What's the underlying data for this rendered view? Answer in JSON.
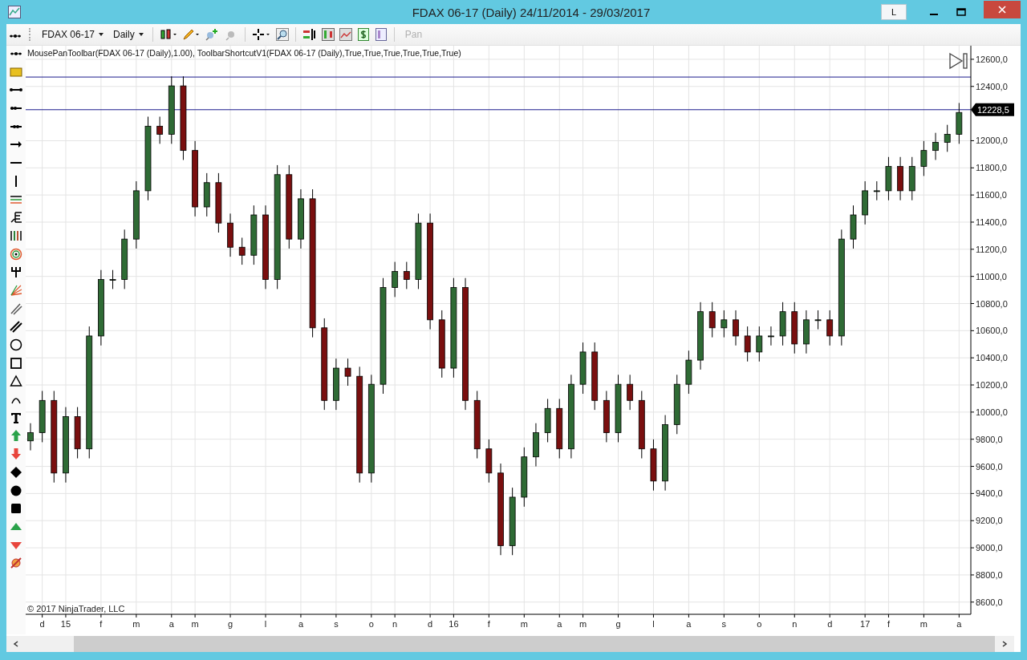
{
  "window": {
    "title": "FDAX 06-17 (Daily)  24/11/2014 - 29/03/2017",
    "title_button": "L"
  },
  "toolbar": {
    "instrument": "FDAX 06-17",
    "interval": "Daily",
    "pan": {
      "label": "Pan",
      "disabled": true
    }
  },
  "chart": {
    "indicator_label": "MousePanToolbar(FDAX 06-17 (Daily),1.00), ToolbarShortcutV1(FDAX 06-17 (Daily),True,True,True,True,True,True)",
    "copyright": "© 2017 NinjaTrader, LLC",
    "chart_data": {
      "type": "candlestick",
      "ylim": [
        8510,
        12700
      ],
      "grid": true,
      "yticks": [
        {
          "value": 12600,
          "label": "12600,0"
        },
        {
          "value": 12400,
          "label": "12400,0"
        },
        {
          "value": 12000,
          "label": "12000,0"
        },
        {
          "value": 11800,
          "label": "11800,0"
        },
        {
          "value": 11600,
          "label": "11600,0"
        },
        {
          "value": 11400,
          "label": "11400,0"
        },
        {
          "value": 11200,
          "label": "11200,0"
        },
        {
          "value": 11000,
          "label": "11000,0"
        },
        {
          "value": 10800,
          "label": "10800,0"
        },
        {
          "value": 10600,
          "label": "10600,0"
        },
        {
          "value": 10400,
          "label": "10400,0"
        },
        {
          "value": 10200,
          "label": "10200,0"
        },
        {
          "value": 10000,
          "label": "10000,0"
        },
        {
          "value": 9800,
          "label": "9800,0"
        },
        {
          "value": 9600,
          "label": "9600,0"
        },
        {
          "value": 9400,
          "label": "9400,0"
        },
        {
          "value": 9200,
          "label": "9200,0"
        },
        {
          "value": 9000,
          "label": "9000,0"
        },
        {
          "value": 8800,
          "label": "8800,0"
        },
        {
          "value": 8600,
          "label": "8600,0"
        }
      ],
      "categories": [
        null,
        "d",
        null,
        "15",
        null,
        null,
        "f",
        null,
        null,
        "m",
        null,
        null,
        "a",
        null,
        "m",
        null,
        null,
        "g",
        null,
        null,
        "l",
        null,
        null,
        "a",
        null,
        null,
        "s",
        null,
        null,
        "o",
        null,
        "n",
        null,
        null,
        "d",
        null,
        "16",
        null,
        null,
        "f",
        null,
        null,
        "m",
        null,
        null,
        "a",
        null,
        "m",
        null,
        null,
        "g",
        null,
        null,
        "l",
        null,
        null,
        "a",
        null,
        null,
        "s",
        null,
        null,
        "o",
        null,
        null,
        "n",
        null,
        null,
        "d",
        null,
        null,
        "17",
        null,
        "f",
        null,
        null,
        "m",
        null,
        null,
        "a"
      ],
      "ohlc": [
        [
          9788,
          9918,
          9718,
          9848
        ],
        [
          9848,
          10156,
          9778,
          10086
        ],
        [
          10086,
          10156,
          9481,
          9551
        ],
        [
          9551,
          10037,
          9481,
          9967
        ],
        [
          9967,
          10037,
          9659,
          9729
        ],
        [
          9729,
          10631,
          9659,
          10561
        ],
        [
          10561,
          11047,
          10491,
          10977
        ],
        [
          10977,
          11047,
          10907,
          10977
        ],
        [
          10977,
          11345,
          10907,
          11275
        ],
        [
          11275,
          11701,
          11205,
          11631
        ],
        [
          11631,
          12177,
          11561,
          12107
        ],
        [
          12107,
          12177,
          11977,
          12047
        ],
        [
          12047,
          12474,
          11977,
          12404
        ],
        [
          12404,
          12474,
          11858,
          11928
        ],
        [
          11928,
          11998,
          11442,
          11512
        ],
        [
          11512,
          11761,
          11442,
          11691
        ],
        [
          11691,
          11761,
          11323,
          11393
        ],
        [
          11393,
          11463,
          11145,
          11215
        ],
        [
          11215,
          11285,
          11086,
          11156
        ],
        [
          11156,
          11523,
          11086,
          11453
        ],
        [
          11453,
          11523,
          10907,
          10977
        ],
        [
          10977,
          11820,
          10907,
          11750
        ],
        [
          11750,
          11820,
          11205,
          11275
        ],
        [
          11275,
          11642,
          11205,
          11572
        ],
        [
          11572,
          11642,
          10551,
          10621
        ],
        [
          10621,
          10691,
          10016,
          10086
        ],
        [
          10086,
          10394,
          10016,
          10324
        ],
        [
          10324,
          10394,
          10194,
          10264
        ],
        [
          10264,
          10334,
          9481,
          9551
        ],
        [
          9551,
          10275,
          9481,
          10205
        ],
        [
          10205,
          10988,
          10135,
          10918
        ],
        [
          10918,
          11107,
          10848,
          11037
        ],
        [
          11037,
          11107,
          10907,
          10977
        ],
        [
          10977,
          11463,
          10907,
          11393
        ],
        [
          11393,
          11463,
          10610,
          10680
        ],
        [
          10680,
          10750,
          10254,
          10324
        ],
        [
          10324,
          10988,
          10254,
          10918
        ],
        [
          10918,
          10988,
          10016,
          10086
        ],
        [
          10086,
          10156,
          9659,
          9729
        ],
        [
          9729,
          9799,
          9481,
          9551
        ],
        [
          9551,
          9621,
          8946,
          9016
        ],
        [
          9016,
          9443,
          8946,
          9373
        ],
        [
          9373,
          9740,
          9303,
          9670
        ],
        [
          9670,
          9918,
          9600,
          9848
        ],
        [
          9848,
          10097,
          9778,
          10027
        ],
        [
          10027,
          10097,
          9659,
          9729
        ],
        [
          9729,
          10275,
          9659,
          10205
        ],
        [
          10205,
          10513,
          10135,
          10443
        ],
        [
          10443,
          10513,
          10016,
          10086
        ],
        [
          10086,
          10156,
          9778,
          9848
        ],
        [
          9848,
          10275,
          9778,
          10205
        ],
        [
          10205,
          10275,
          10016,
          10086
        ],
        [
          10086,
          10156,
          9659,
          9729
        ],
        [
          9729,
          9799,
          9422,
          9492
        ],
        [
          9492,
          9978,
          9422,
          9908
        ],
        [
          9908,
          10275,
          9838,
          10205
        ],
        [
          10205,
          10453,
          10135,
          10383
        ],
        [
          10383,
          10810,
          10313,
          10740
        ],
        [
          10740,
          10810,
          10551,
          10621
        ],
        [
          10621,
          10750,
          10551,
          10680
        ],
        [
          10680,
          10750,
          10491,
          10561
        ],
        [
          10561,
          10631,
          10373,
          10443
        ],
        [
          10443,
          10631,
          10373,
          10561
        ],
        [
          10561,
          10631,
          10491,
          10561
        ],
        [
          10561,
          10810,
          10491,
          10740
        ],
        [
          10740,
          10810,
          10432,
          10502
        ],
        [
          10502,
          10750,
          10432,
          10680
        ],
        [
          10680,
          10750,
          10610,
          10680
        ],
        [
          10680,
          10750,
          10491,
          10561
        ],
        [
          10561,
          11345,
          10491,
          11275
        ],
        [
          11275,
          11523,
          11205,
          11453
        ],
        [
          11453,
          11701,
          11383,
          11631
        ],
        [
          11631,
          11701,
          11561,
          11631
        ],
        [
          11631,
          11880,
          11561,
          11810
        ],
        [
          11810,
          11880,
          11561,
          11631
        ],
        [
          11631,
          11880,
          11561,
          11810
        ],
        [
          11810,
          11998,
          11740,
          11928
        ],
        [
          11928,
          12058,
          11858,
          11988
        ],
        [
          11988,
          12117,
          11918,
          12047
        ],
        [
          12047,
          12278,
          11977,
          12208
        ]
      ],
      "ref_lines": [
        {
          "axis": "y",
          "value": 12469,
          "color": "#1a1a8c"
        },
        {
          "axis": "y",
          "value": 12228.5,
          "label": "12228,5",
          "color": "#1a1a8c"
        }
      ]
    }
  }
}
